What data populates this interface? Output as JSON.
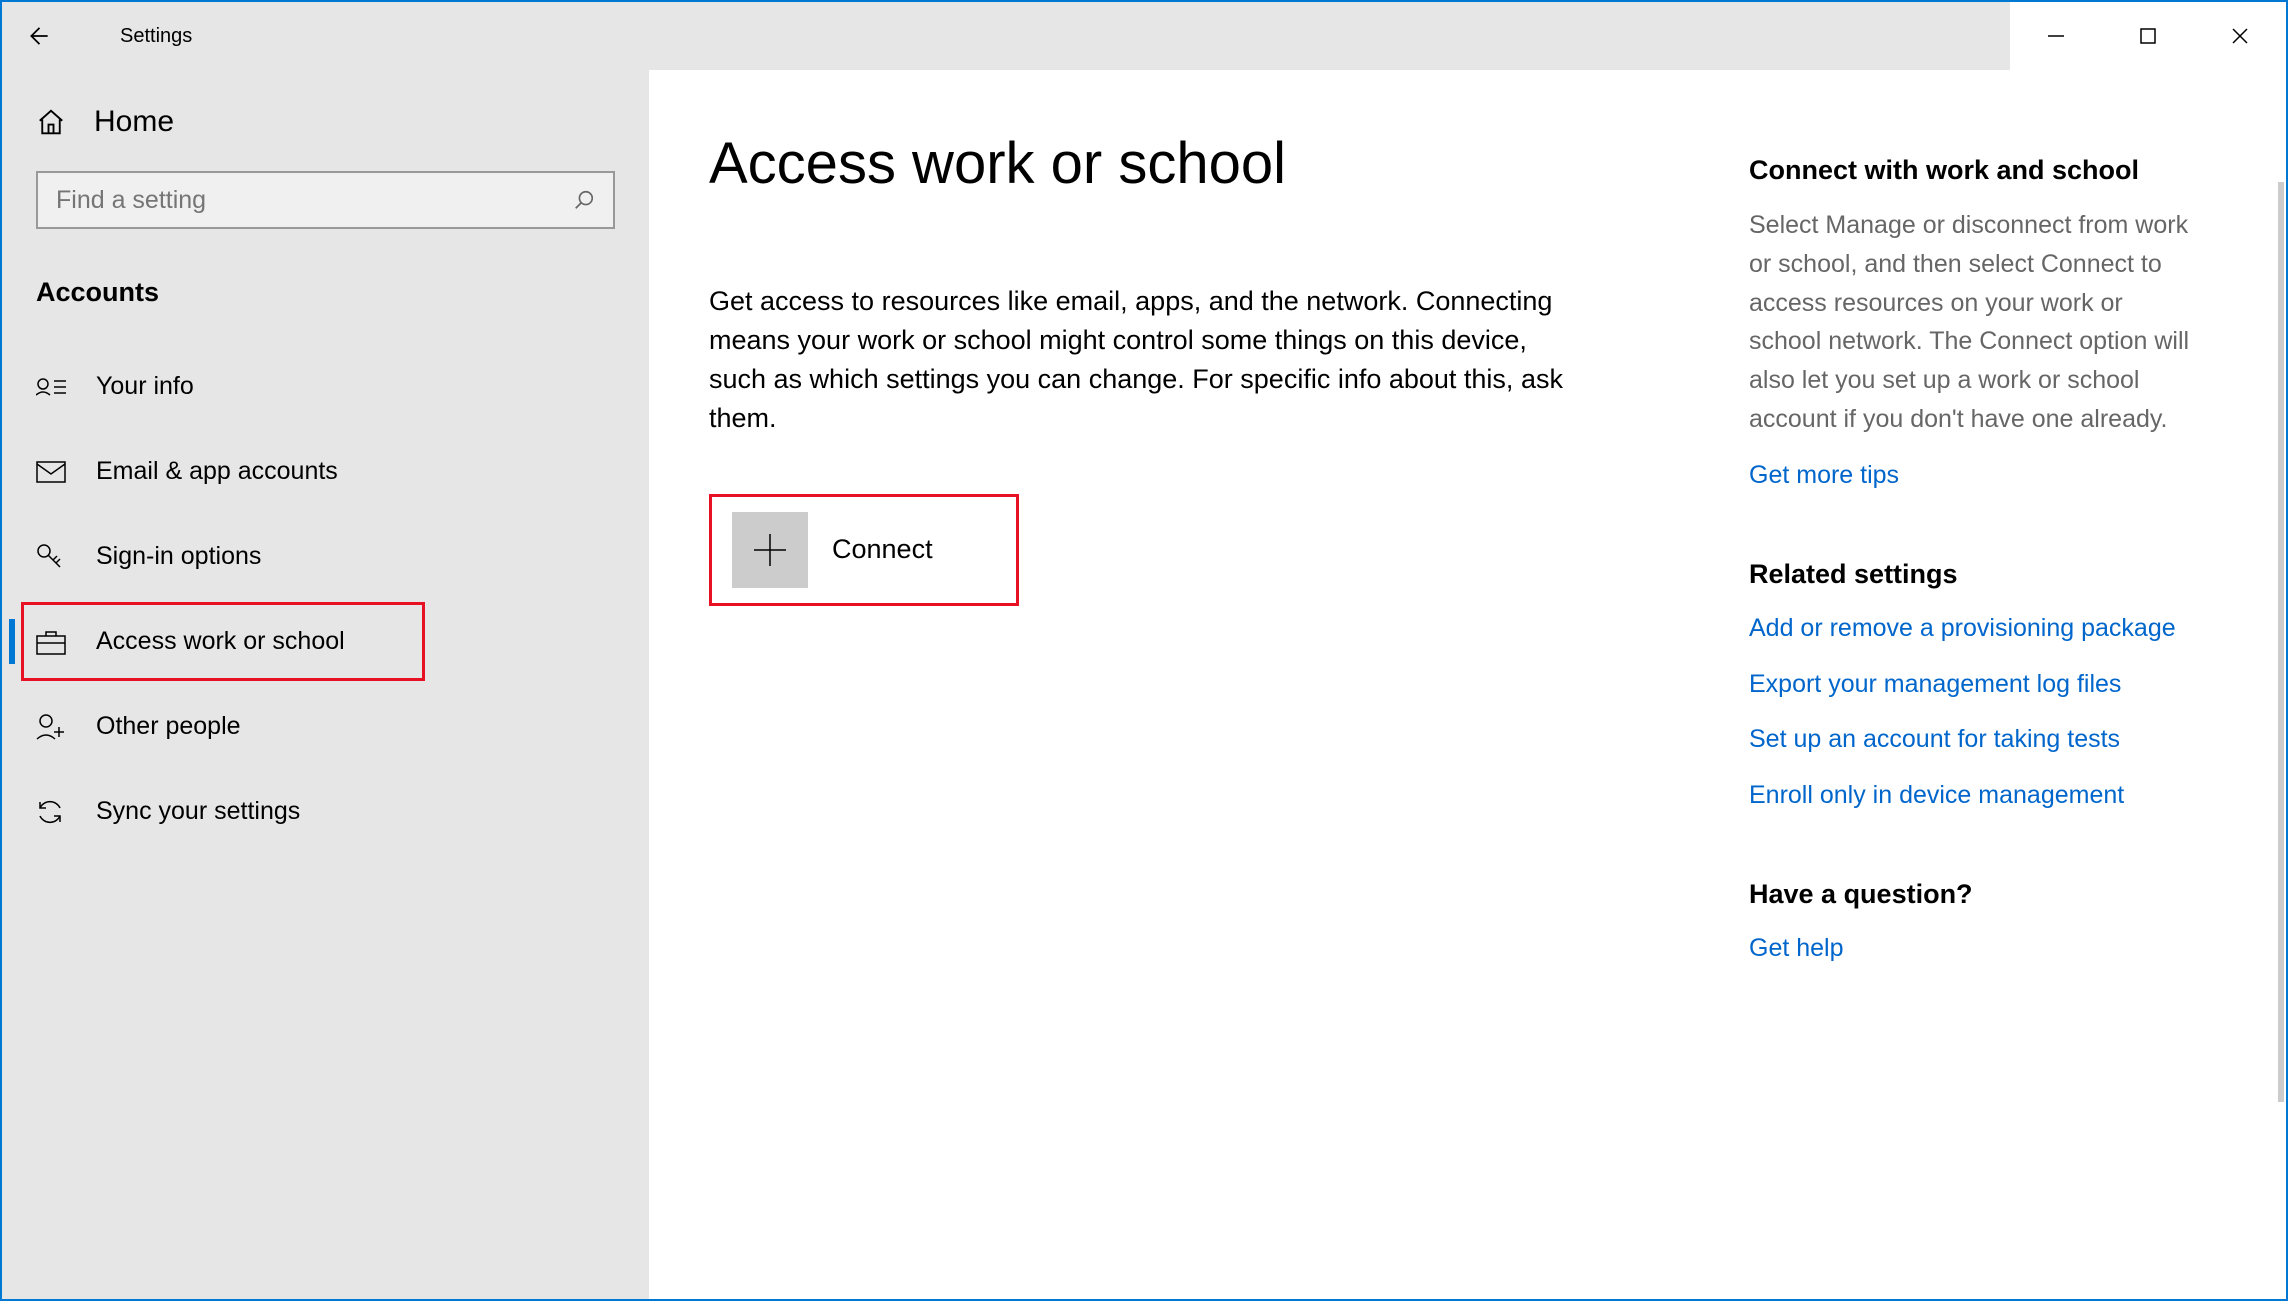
{
  "titlebar": {
    "title": "Settings"
  },
  "sidebar": {
    "home": "Home",
    "search_placeholder": "Find a setting",
    "section": "Accounts",
    "items": [
      {
        "label": "Your info"
      },
      {
        "label": "Email & app accounts"
      },
      {
        "label": "Sign-in options"
      },
      {
        "label": "Access work or school"
      },
      {
        "label": "Other people"
      },
      {
        "label": "Sync your settings"
      }
    ]
  },
  "main": {
    "heading": "Access work or school",
    "description": "Get access to resources like email, apps, and the network. Connecting means your work or school might control some things on this device, such as which settings you can change. For specific info about this, ask them.",
    "connect_label": "Connect"
  },
  "right": {
    "section1": {
      "heading": "Connect with work and school",
      "body": "Select Manage or disconnect from work or school, and then select Connect to access resources on your work or school network. The Connect option will also let you set up a work or school account if you don't have one already.",
      "link": "Get more tips"
    },
    "section2": {
      "heading": "Related settings",
      "links": [
        "Add or remove a provisioning package",
        "Export your management log files",
        "Set up an account for taking tests",
        "Enroll only in device management"
      ]
    },
    "section3": {
      "heading": "Have a question?",
      "link": "Get help"
    }
  }
}
